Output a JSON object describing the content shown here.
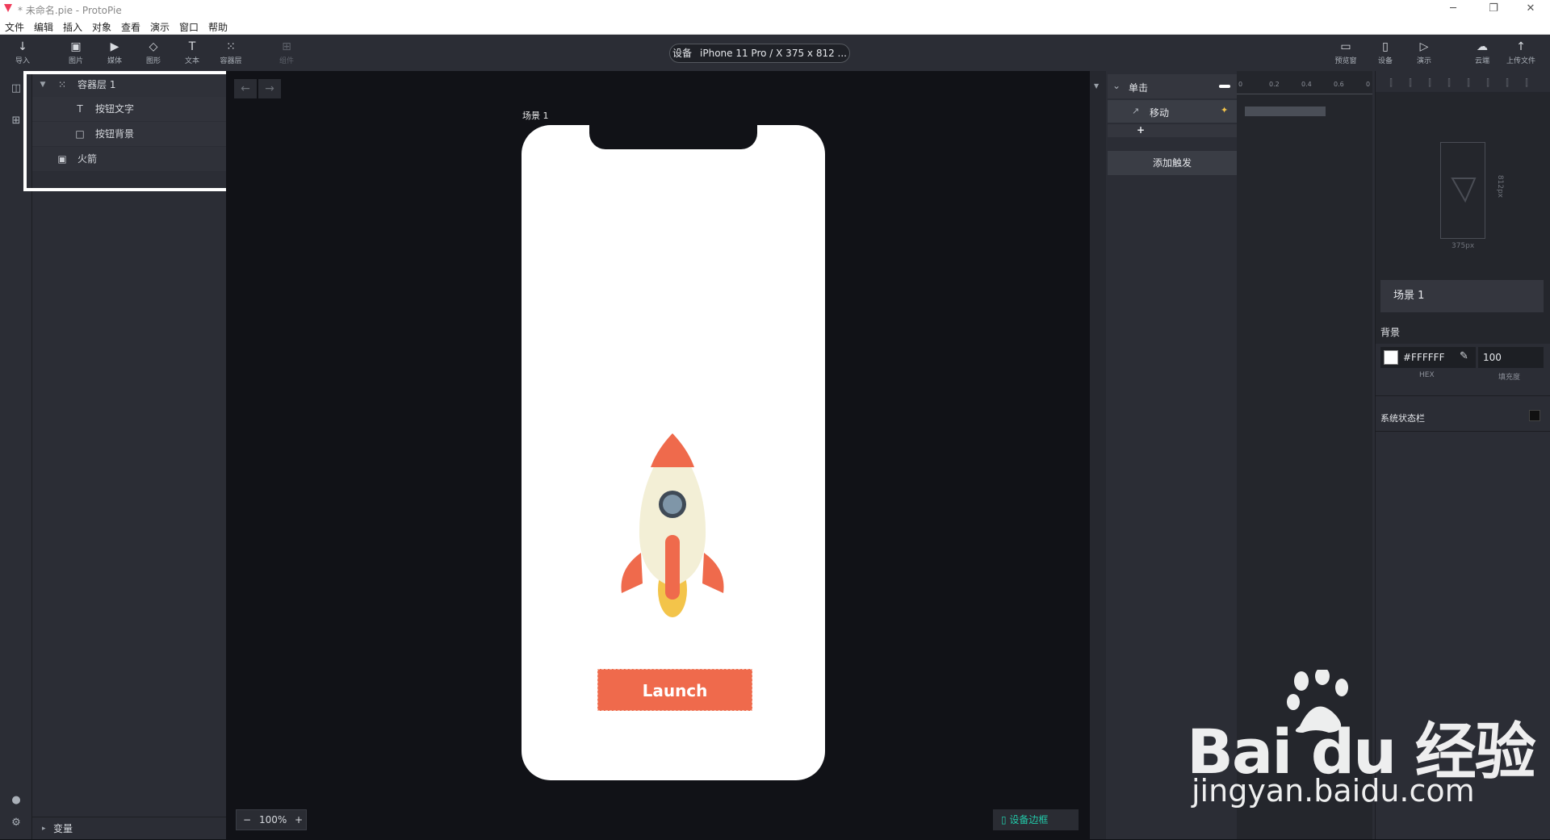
{
  "window": {
    "title": "* 未命名.pie - ProtoPie",
    "controls": [
      "─",
      "❐",
      "✕"
    ]
  },
  "menu": [
    "文件",
    "编辑",
    "插入",
    "对象",
    "查看",
    "演示",
    "窗口",
    "帮助"
  ],
  "toolbar": {
    "left": [
      {
        "icon": "import-icon",
        "glyph": "↓",
        "label": "导入"
      },
      {
        "icon": "image-icon",
        "glyph": "▣",
        "label": "图片"
      },
      {
        "icon": "media-icon",
        "glyph": "▶",
        "label": "媒体"
      },
      {
        "icon": "shape-icon",
        "glyph": "◇",
        "label": "图形"
      },
      {
        "icon": "text-icon",
        "glyph": "T",
        "label": "文本"
      },
      {
        "icon": "container-icon",
        "glyph": "⁙",
        "label": "容器层"
      },
      {
        "icon": "component-icon",
        "glyph": "⊞",
        "label": "组件"
      }
    ],
    "device_label": "设备",
    "device_value": "iPhone 11 Pro / X  375 x 812 ...",
    "right": [
      {
        "icon": "preview-window-icon",
        "glyph": "▭",
        "label": "预览窗"
      },
      {
        "icon": "device-icon",
        "glyph": "▯",
        "label": "设备"
      },
      {
        "icon": "present-icon",
        "glyph": "▷",
        "label": "演示"
      },
      {
        "icon": "cloud-icon",
        "glyph": "☁",
        "label": "云端"
      },
      {
        "icon": "upload-icon",
        "glyph": "↑",
        "label": "上传文件"
      }
    ]
  },
  "layers": {
    "items": [
      {
        "name": "容器层 1",
        "glyph": "⁙"
      },
      {
        "name": "按钮文字",
        "glyph": "T"
      },
      {
        "name": "按钮背景",
        "glyph": "□"
      },
      {
        "name": "火箭",
        "glyph": "▣"
      }
    ],
    "variables": "变量"
  },
  "canvas": {
    "scene_label": "场景 1",
    "button_text": "Launch",
    "zoom": "100%",
    "device_frame": "设备边框"
  },
  "interactions": {
    "trigger": "单击",
    "response": "移动",
    "add_symbol": "+",
    "add_trigger": "添加触发",
    "ruler": [
      "0",
      "0.2",
      "0.4",
      "0.6",
      "0"
    ]
  },
  "properties": {
    "size_w": "375px",
    "size_h": "812px",
    "scene_name": "场景 1",
    "bg_label": "背景",
    "hex": "#FFFFFF",
    "hex_sub": "HEX",
    "opacity": "100",
    "opacity_sub": "填充度",
    "status_bar": "系统状态栏"
  },
  "colors": {
    "accent": "#22c8a8",
    "rocket_red": "#ef6a4c",
    "rocket_body": "#f3efd6",
    "flame": "#f3c44a",
    "window": "#7f96a8"
  },
  "watermark": {
    "brand": "Bai du 经验",
    "url": "jingyan.baidu.com"
  }
}
